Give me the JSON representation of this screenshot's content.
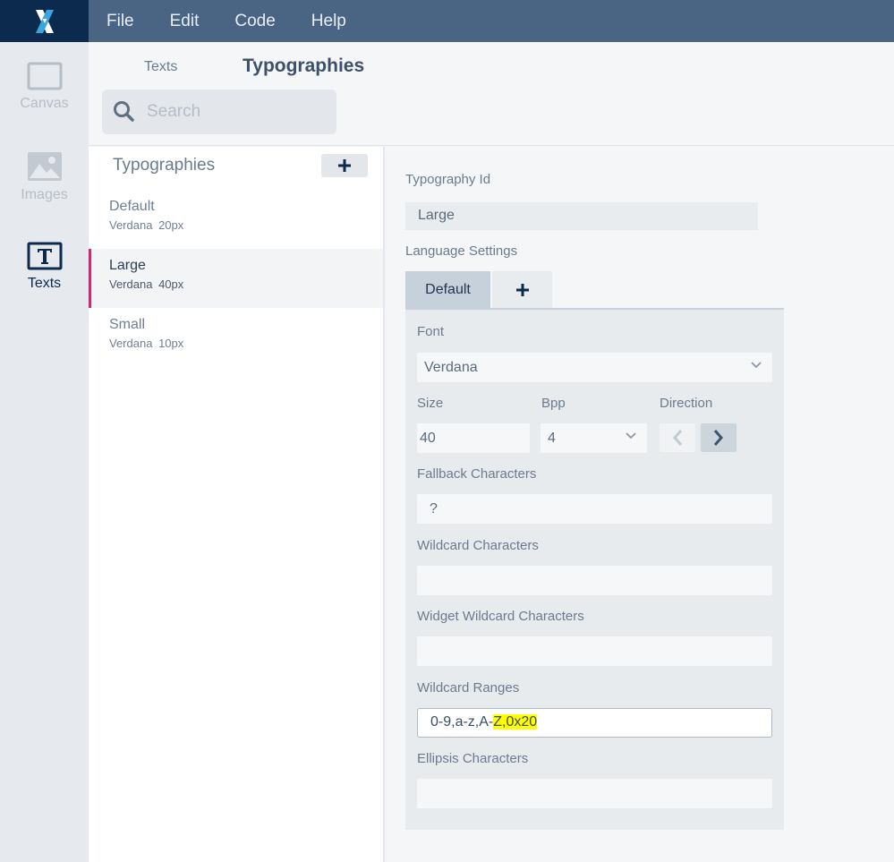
{
  "menu": {
    "items": [
      "File",
      "Edit",
      "Code",
      "Help"
    ]
  },
  "rail": {
    "items": [
      {
        "label": "Canvas",
        "icon": "canvas-icon"
      },
      {
        "label": "Images",
        "icon": "image-icon"
      },
      {
        "label": "Texts",
        "icon": "text-icon",
        "active": true
      }
    ]
  },
  "header": {
    "tabs": [
      "Texts",
      "Typographies"
    ],
    "search_placeholder": "Search"
  },
  "list": {
    "title": "Typographies",
    "items": [
      {
        "name": "Default",
        "font": "Verdana",
        "size": "20px"
      },
      {
        "name": "Large",
        "font": "Verdana",
        "size": "40px",
        "selected": true
      },
      {
        "name": "Small",
        "font": "Verdana",
        "size": "10px"
      }
    ]
  },
  "detail": {
    "id_label": "Typography Id",
    "id_value": "Large",
    "lang_label": "Language Settings",
    "lang_tab": "Default",
    "font_label": "Font",
    "font_value": "Verdana",
    "size_label": "Size",
    "size_value": "40",
    "bpp_label": "Bpp",
    "bpp_value": "4",
    "direction_label": "Direction",
    "fallback_label": "Fallback Characters",
    "fallback_value": "?",
    "wildcard_label": "Wildcard Characters",
    "wildcard_value": "",
    "widget_wildcard_label": "Widget Wildcard Characters",
    "widget_wildcard_value": "",
    "ranges_label": "Wildcard Ranges",
    "ranges_value_plain": "0-9,a-z,A-",
    "ranges_value_highlight": "Z,0x20",
    "ellipsis_label": "Ellipsis Characters",
    "ellipsis_value": ""
  },
  "colors": {
    "accent": "#d6246e",
    "topbar": "#4a6584",
    "logo_bg": "#0c2a4d",
    "highlight": "#ffff00"
  }
}
